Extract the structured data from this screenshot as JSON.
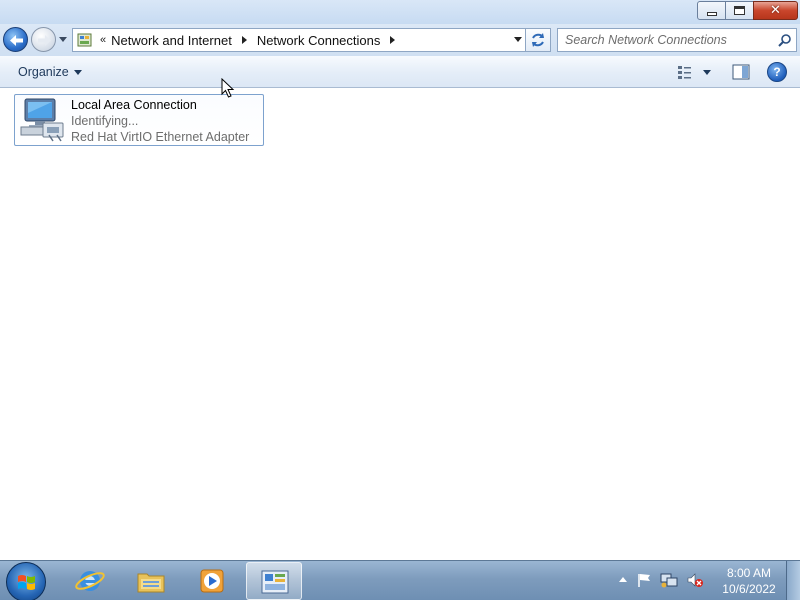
{
  "window": {
    "controls": {
      "minimize": "minimize",
      "maximize": "restore",
      "close": "close"
    }
  },
  "address_bar": {
    "overflow_chevron": "«",
    "breadcrumbs": [
      "Network and Internet",
      "Network Connections"
    ]
  },
  "search": {
    "placeholder": "Search Network Connections"
  },
  "command_bar": {
    "organize_label": "Organize",
    "help_label": "?"
  },
  "connections": [
    {
      "name": "Local Area Connection",
      "status": "Identifying...",
      "adapter": "Red Hat VirtIO Ethernet Adapter",
      "icon": "network-adapter-icon"
    }
  ],
  "taskbar": {
    "pinned": [
      {
        "name": "internet-explorer",
        "icon": "ie-icon"
      },
      {
        "name": "windows-explorer",
        "icon": "folder-icon"
      },
      {
        "name": "media-player",
        "icon": "media-player-icon"
      },
      {
        "name": "network-connections",
        "icon": "control-panel-icon",
        "active": true
      }
    ],
    "tray_icons": [
      "show-hidden-icons",
      "action-center-flag-icon",
      "network-icon",
      "volume-muted-icon"
    ],
    "clock": {
      "time": "8:00 AM",
      "date": "10/6/2022"
    }
  },
  "colors": {
    "titlebar": "#c7dbf2",
    "close_button": "#c9462c",
    "selection_border": "#7da2ce",
    "taskbar": "#7e9cbd",
    "link_text": "#1e395b"
  }
}
